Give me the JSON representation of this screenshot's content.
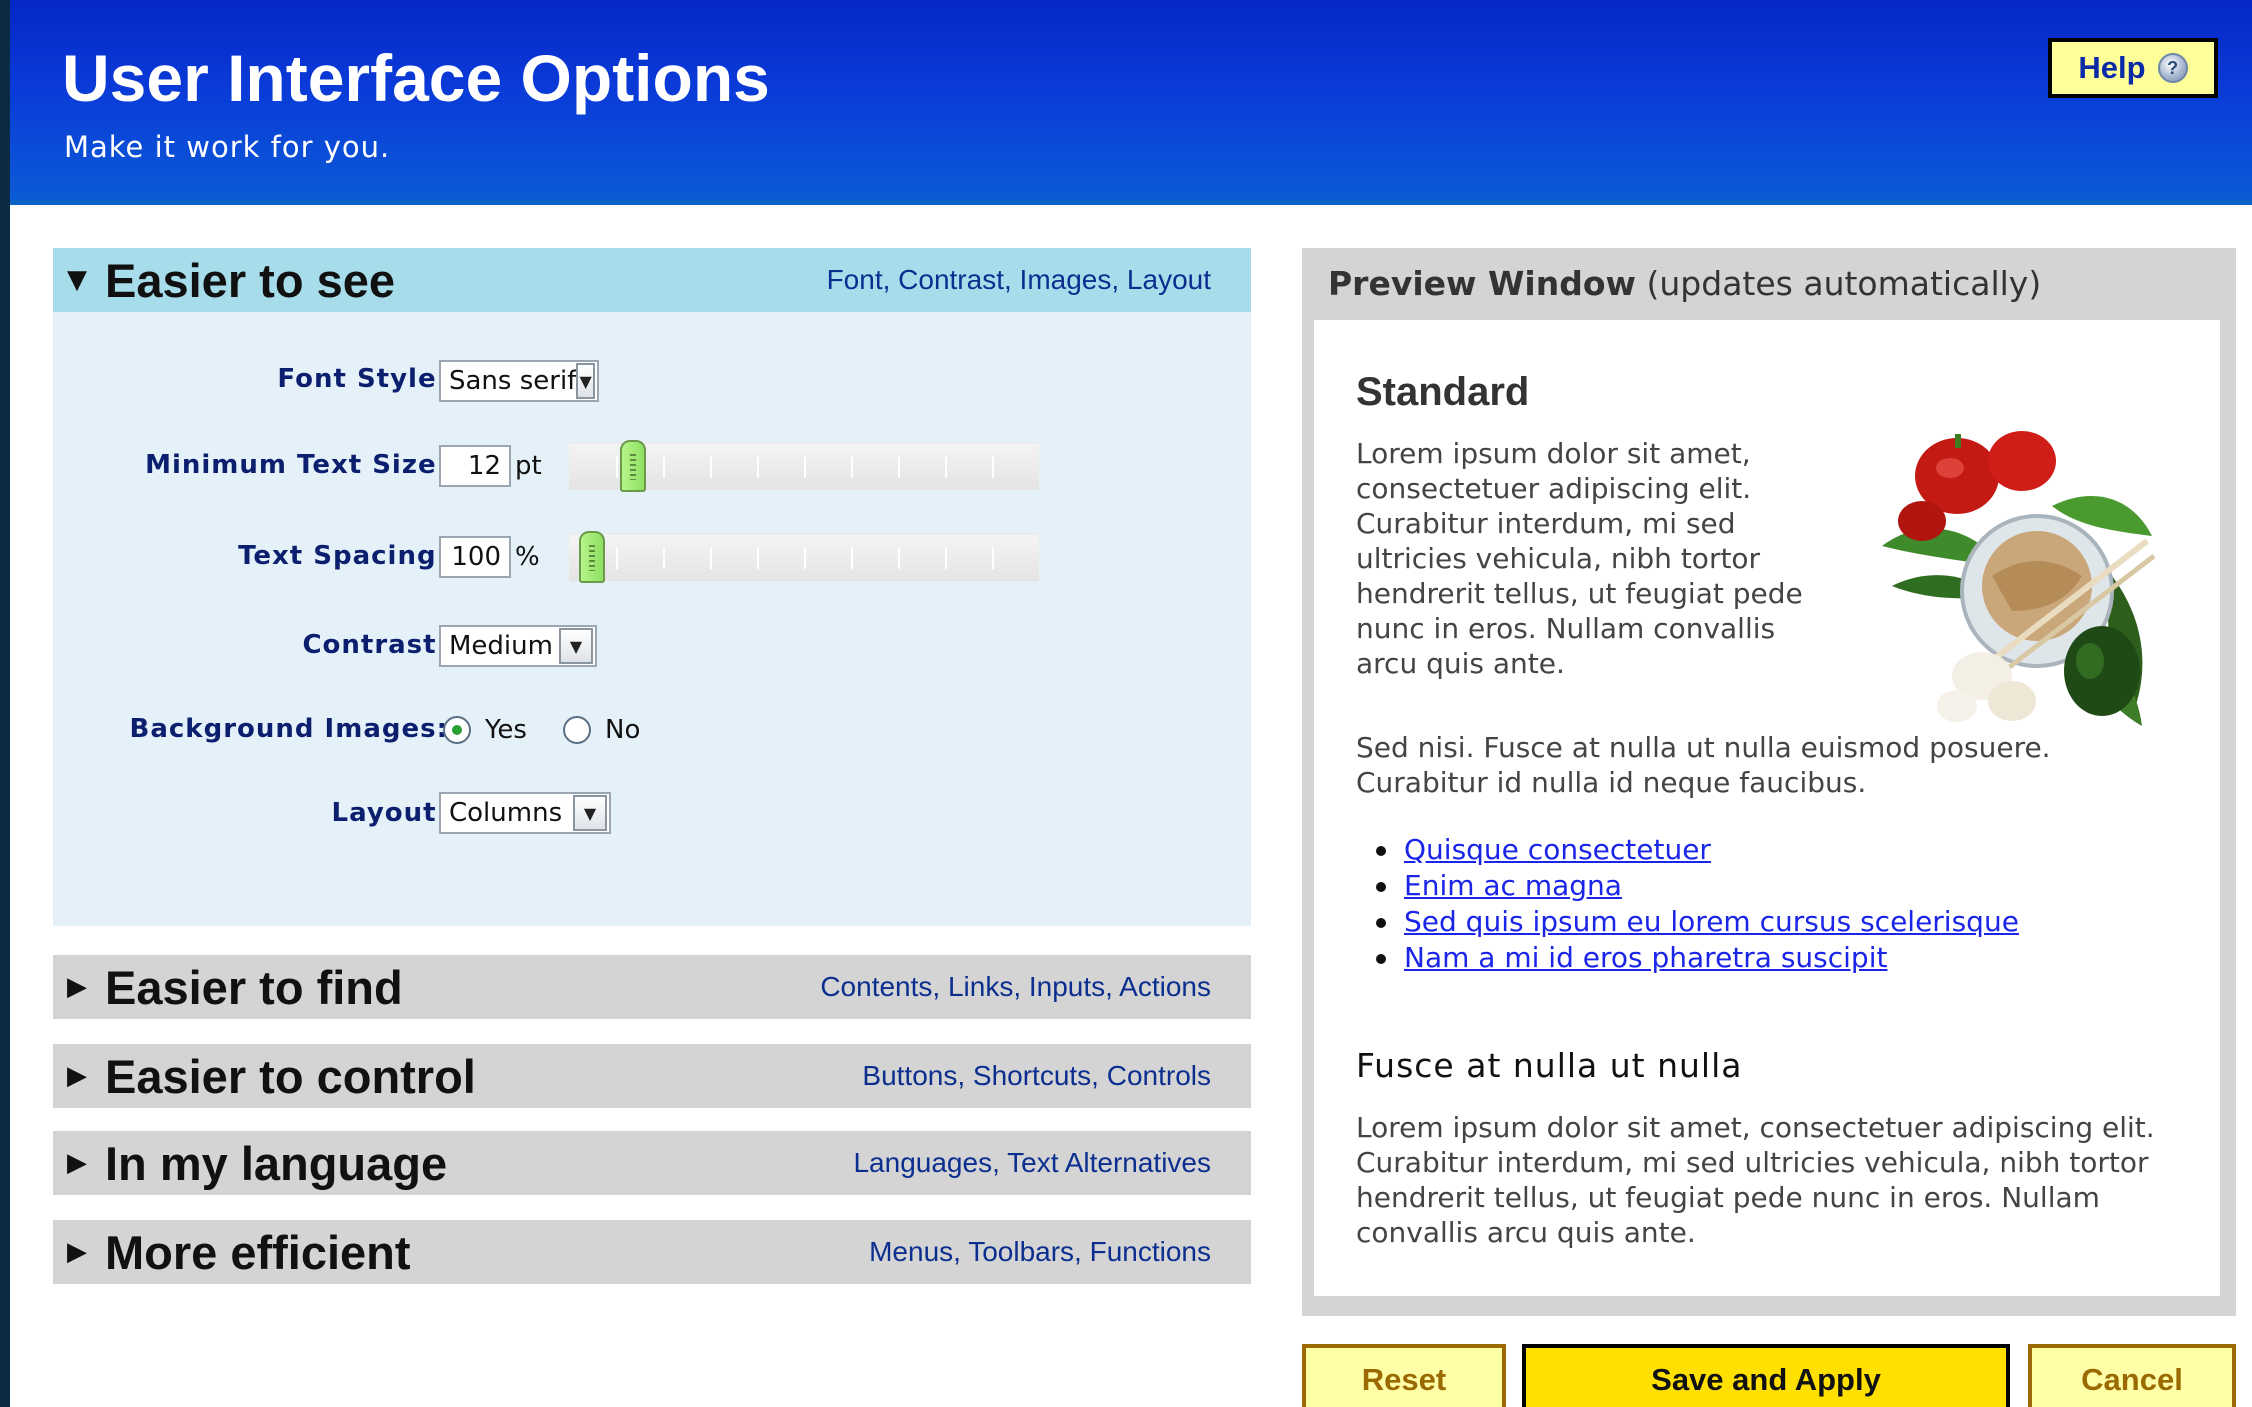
{
  "header": {
    "title": "User Interface Options",
    "subtitle": "Make it work for you.",
    "help_label": "Help",
    "help_icon": "help-circle-icon"
  },
  "panels": [
    {
      "title": "Easier to see",
      "links": "Font, Contrast, Images, Layout",
      "expanded": true
    },
    {
      "title": "Easier to find",
      "links": "Contents, Links, Inputs, Actions",
      "expanded": false
    },
    {
      "title": "Easier to control",
      "links": "Buttons, Shortcuts, Controls",
      "expanded": false
    },
    {
      "title": "In my language",
      "links": "Languages, Text Alternatives",
      "expanded": false
    },
    {
      "title": "More efficient",
      "links": "Menus, Toolbars, Functions",
      "expanded": false
    }
  ],
  "easier_to_see": {
    "font_style": {
      "label": "Font Style:",
      "value": "Sans serif"
    },
    "min_text_size": {
      "label": "Minimum Text Size:",
      "value": "12",
      "unit": "pt",
      "slider_level": 0.1
    },
    "text_spacing": {
      "label": "Text Spacing:",
      "value": "100",
      "unit": "%",
      "slider_level": 0.0
    },
    "contrast": {
      "label": "Contrast:",
      "value": "Medium"
    },
    "background_images": {
      "label": "Background Images:",
      "options": [
        "Yes",
        "No"
      ],
      "selected": "Yes"
    },
    "layout": {
      "label": "Layout:",
      "value": "Columns"
    }
  },
  "preview": {
    "title": "Preview Window",
    "title_note": "(updates automatically)",
    "heading": "Standard",
    "paragraph1": "Lorem ipsum dolor sit amet, consectetuer adipiscing elit. Curabitur interdum, mi sed ultricies vehicula, nibh tortor hendrerit tellus, ut feugiat pede nunc in eros. Nullam convallis arcu quis ante.",
    "paragraph2": "Sed nisi. Fusce at nulla ut nulla euismod posuere. Curabitur id nulla id neque faucibus.",
    "links": [
      "Quisque consectetuer ",
      "Enim ac magna",
      "Sed quis ipsum eu lorem cursus scelerisque",
      "Nam a mi id eros pharetra suscipit"
    ],
    "subheading": "Fusce at nulla ut nulla",
    "paragraph3": "Lorem ipsum dolor sit amet, consectetuer adipiscing elit. Curabitur interdum, mi sed ultricies vehicula, nibh tortor hendrerit tellus, ut feugiat pede nunc in eros. Nullam convallis arcu quis ante.",
    "image": "vegetables-bowl-image"
  },
  "actions": {
    "reset": "Reset",
    "save_apply": "Save and Apply",
    "cancel": "Cancel"
  },
  "colors": {
    "header_blue": "#0627c7",
    "open_panel": "#a7dcea",
    "closed_panel": "#d4d4d4",
    "save_button": "#ffe000",
    "link_blue": "#1a25e8"
  }
}
